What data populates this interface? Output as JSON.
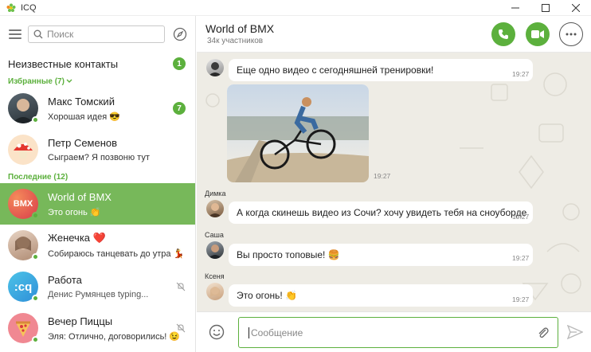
{
  "app": {
    "title": "ICQ"
  },
  "search": {
    "placeholder": "Поиск"
  },
  "unknown_contacts": {
    "label": "Неизвестные контакты",
    "count": "1"
  },
  "favorites": {
    "label": "Избранные (7)",
    "contacts": [
      {
        "name": "Макс Томский",
        "message": "Хорошая идея 😎",
        "badge": "7",
        "avatar_color": "#3a4a56"
      },
      {
        "name": "Петр Семенов",
        "message": "Сыграем? Я позвоню тут",
        "avatar_color": "#f2d5b0"
      }
    ]
  },
  "recent": {
    "label": "Последние (12)",
    "contacts": [
      {
        "name": "World of BMX",
        "message": "Это огонь 👏",
        "avatar_text": "BMX",
        "avatar_color": "#e8574a",
        "active": true
      },
      {
        "name": "Женечка ❤️",
        "message": "Собираюсь танцевать до утра 💃",
        "avatar_color": "#d9b8a0"
      },
      {
        "name": "Работа",
        "message": "Денис Румянцев typing...",
        "avatar_text": ":cq",
        "avatar_color": "#3fa9e0",
        "muted": true
      },
      {
        "name": "Вечер Пиццы",
        "message": "Эля: Отлично, договорились! 😉",
        "avatar_color": "#f07a85",
        "muted": true
      }
    ]
  },
  "chat": {
    "title": "World of BMX",
    "subtitle": "34к участников",
    "messages": [
      {
        "text": "Еще одно видео с сегодняшней тренировки!",
        "time": "19:27"
      },
      {
        "type": "photo",
        "time": "19:27"
      },
      {
        "sender": "Димка",
        "text": "А когда скинешь видео из Сочи? хочу увидеть тебя на сноуборде",
        "time": "19:27"
      },
      {
        "sender": "Саша",
        "text": "Вы просто топовые! 🍔",
        "time": "19:27"
      },
      {
        "sender": "Ксеня",
        "text": "Это огонь! 👏",
        "time": "19:27"
      }
    ]
  },
  "composer": {
    "placeholder": "Сообщение"
  },
  "colors": {
    "accent": "#5cb03d",
    "active_row": "#77b85a",
    "chat_bg": "#eeece5"
  }
}
